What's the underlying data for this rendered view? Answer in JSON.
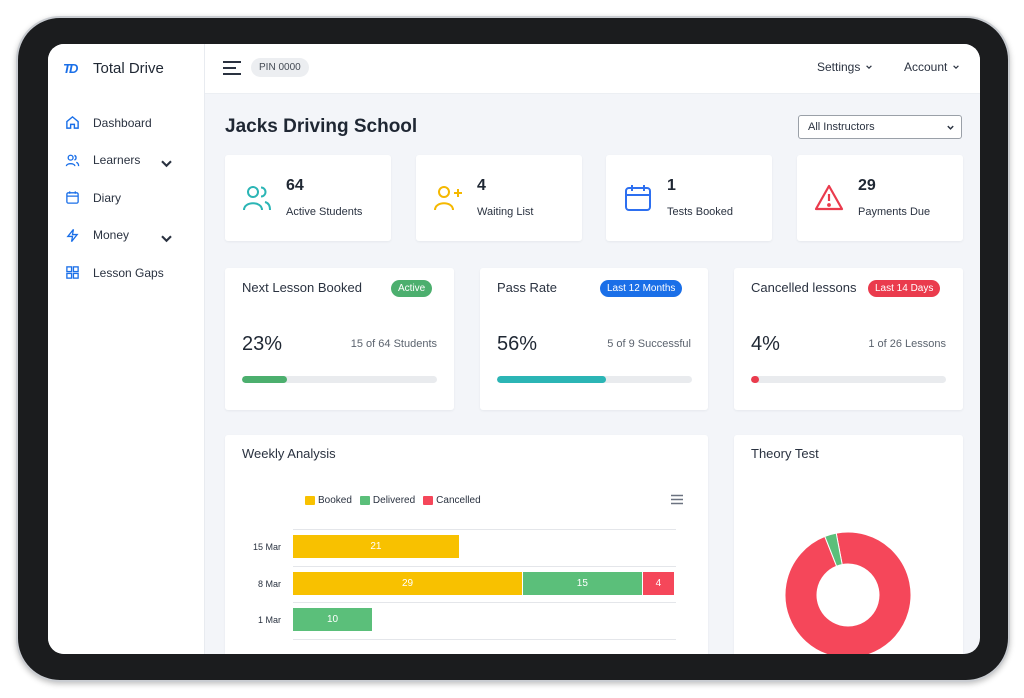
{
  "app": {
    "name": "Total Drive",
    "logo_mark": "TD"
  },
  "sidebar": {
    "items": [
      {
        "label": "Dashboard",
        "icon": "home-icon",
        "has_chevron": false
      },
      {
        "label": "Learners",
        "icon": "users-icon",
        "has_chevron": true
      },
      {
        "label": "Diary",
        "icon": "calendar-icon",
        "has_chevron": false
      },
      {
        "label": "Money",
        "icon": "lightning-icon",
        "has_chevron": true
      },
      {
        "label": "Lesson Gaps",
        "icon": "grid-icon",
        "has_chevron": false
      }
    ]
  },
  "topbar": {
    "pin": "PIN 0000",
    "settings": "Settings",
    "account": "Account"
  },
  "page": {
    "title": "Jacks Driving School",
    "instructor_filter": "All Instructors"
  },
  "stats": [
    {
      "value": "64",
      "label": "Active Students",
      "icon": "users-icon",
      "color": "#2bb5b5"
    },
    {
      "value": "4",
      "label": "Waiting List",
      "icon": "user-plus-icon",
      "color": "#f5b800"
    },
    {
      "value": "1",
      "label": "Tests Booked",
      "icon": "calendar-icon",
      "color": "#2d6ff0"
    },
    {
      "value": "29",
      "label": "Payments Due",
      "icon": "warning-icon",
      "color": "#ea3b4d"
    }
  ],
  "metrics": [
    {
      "title": "Next Lesson Booked",
      "badge": "Active",
      "badge_color": "#4caf6e",
      "pct": "23%",
      "sub": "15 of 64 Students",
      "fill_fraction": 0.23,
      "fill_color": "#4caf6e"
    },
    {
      "title": "Pass Rate",
      "badge": "Last 12 Months",
      "badge_color": "#1a6fe8",
      "pct": "56%",
      "sub": "5 of 9 Successful",
      "fill_fraction": 0.56,
      "fill_color": "#2bb5b5"
    },
    {
      "title": "Cancelled lessons",
      "badge": "Last 14 Days",
      "badge_color": "#ea3b4d",
      "pct": "4%",
      "sub": "1 of 26 Lessons",
      "fill_fraction": 0.04,
      "fill_color": "#ea3b4d"
    }
  ],
  "weekly": {
    "title": "Weekly Analysis",
    "chart_data": {
      "type": "bar",
      "orientation": "horizontal",
      "stacked": true,
      "categories": [
        "15 Mar",
        "8 Mar",
        "1 Mar"
      ],
      "series": [
        {
          "name": "Booked",
          "color": "#f8c100",
          "values": [
            21,
            29,
            0
          ]
        },
        {
          "name": "Delivered",
          "color": "#5bbf7a",
          "values": [
            0,
            15,
            10
          ]
        },
        {
          "name": "Cancelled",
          "color": "#f5475a",
          "values": [
            0,
            4,
            0
          ]
        }
      ]
    }
  },
  "theory": {
    "title": "Theory Test",
    "chart_data": {
      "type": "pie",
      "donut": true,
      "values": [
        97,
        3
      ],
      "colors": [
        "#f5475a",
        "#5bbf7a"
      ]
    }
  }
}
